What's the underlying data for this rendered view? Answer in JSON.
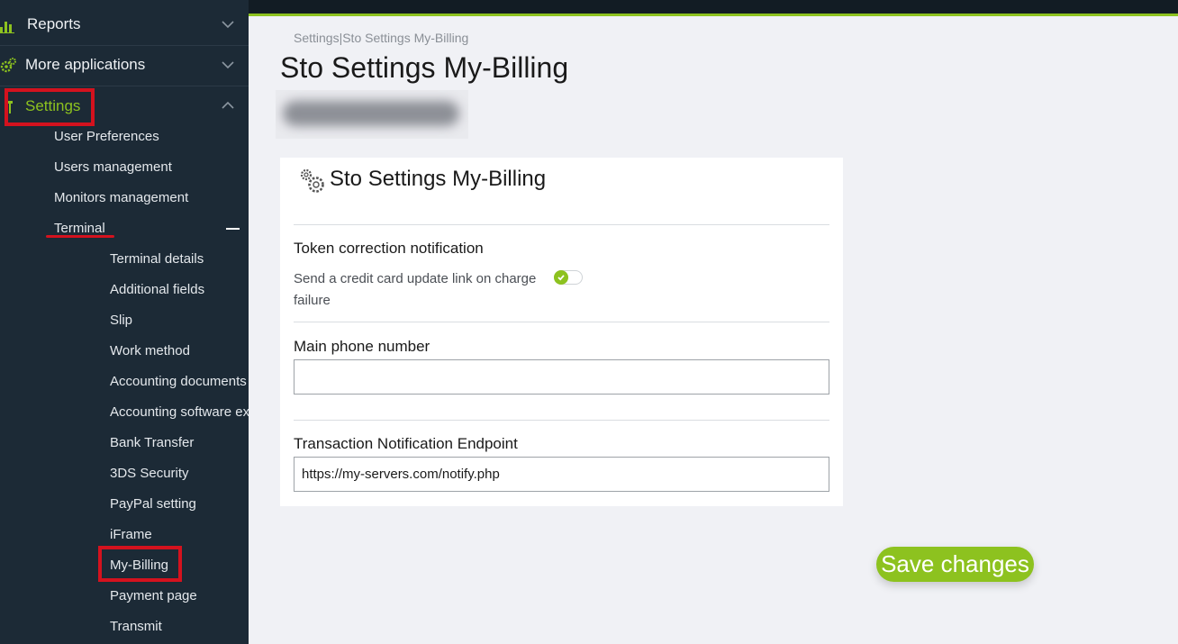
{
  "sidebar": {
    "groups": [
      {
        "label": "Reports",
        "icon": "bar-chart-icon",
        "expanded": false
      },
      {
        "label": "More applications",
        "icon": "gears-icon",
        "expanded": false
      },
      {
        "label": "Settings",
        "icon": "settings-icon",
        "expanded": true
      }
    ],
    "settings_items": [
      "User Preferences",
      "Users management",
      "Monitors management",
      "Terminal"
    ],
    "terminal_items": [
      "Terminal details",
      "Additional fields",
      "Slip",
      "Work method",
      "Accounting documents",
      "Accounting software export",
      "Bank Transfer",
      "3DS Security",
      "PayPal setting",
      "iFrame",
      "My-Billing",
      "Payment page",
      "Transmit"
    ]
  },
  "colors": {
    "sidebar_bg": "#1c2a36",
    "accent": "#8dc21f",
    "highlight_red": "#d4121e"
  },
  "main": {
    "breadcrumb": "Settings|Sto Settings My-Billing",
    "title": "Sto Settings My-Billing",
    "card": {
      "title": "Sto Settings My-Billing",
      "token_section": {
        "label": "Token correction notification",
        "description": "Send a credit card update link on charge failure",
        "enabled": true
      },
      "phone": {
        "label": "Main phone number",
        "value": ""
      },
      "endpoint": {
        "label": "Transaction Notification Endpoint",
        "value": "https://my-servers.com/notify.php"
      }
    },
    "save_label": "Save changes"
  }
}
